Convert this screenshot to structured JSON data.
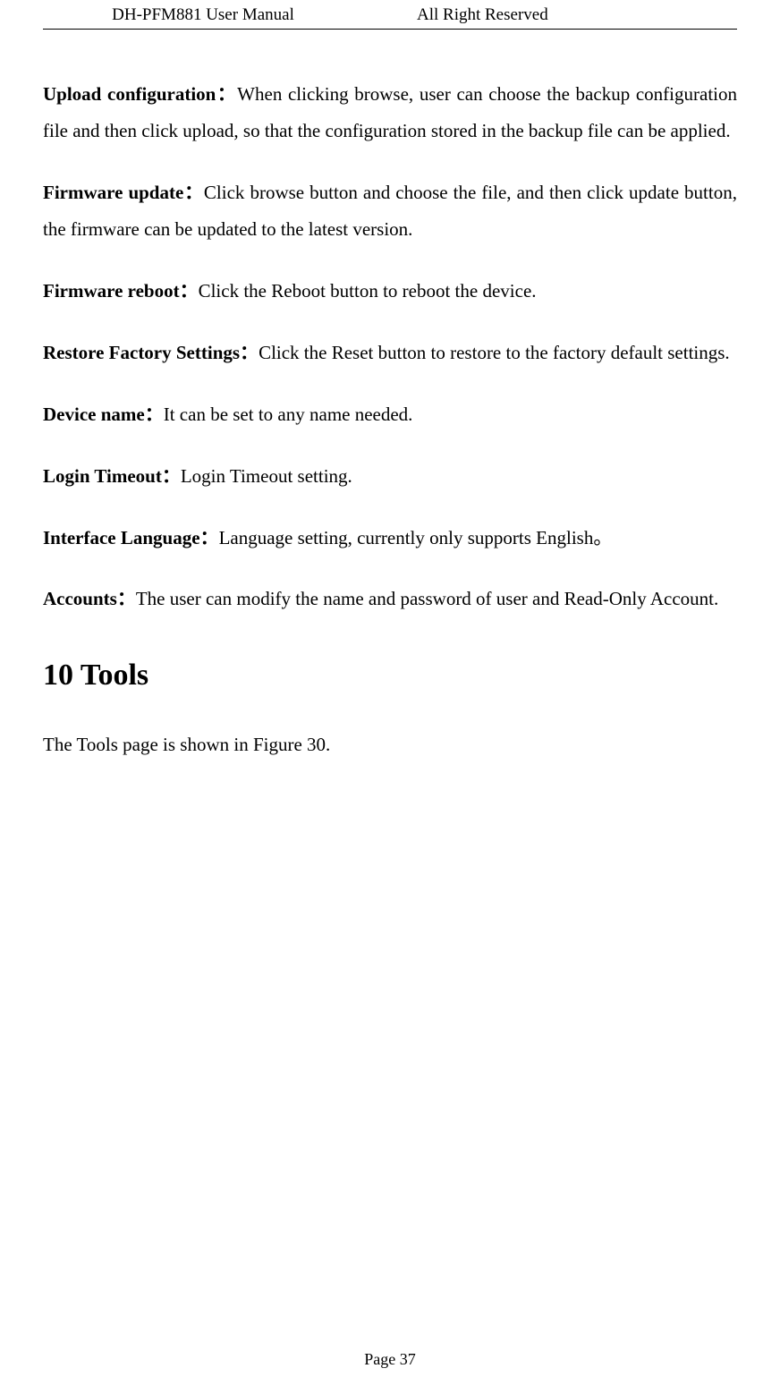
{
  "header": {
    "left": "DH-PFM881 User Manual",
    "right": "All Right Reserved"
  },
  "paragraphs": [
    {
      "bold": "Upload configuration：",
      "text": "When clicking browse, user can choose the backup configuration file and then click upload, so that the configuration stored in the backup file can be applied."
    },
    {
      "bold": "Firmware update：",
      "text": "Click browse button and choose the file, and then click update button, the firmware can be updated to the latest version."
    },
    {
      "bold": "Firmware reboot：",
      "text": "Click the Reboot button to reboot the device."
    },
    {
      "bold": "Restore Factory Settings：",
      "text": "Click the Reset button to restore to the factory default settings."
    },
    {
      "bold": "Device name：",
      "text": "It can be set to any name needed."
    },
    {
      "bold": "Login Timeout：",
      "text": "Login Timeout setting."
    },
    {
      "bold": "Interface Language：",
      "text": "Language setting, currently only supports English。"
    },
    {
      "bold": "Accounts：",
      "text": "The user can modify the name and password of user and Read-Only Account."
    }
  ],
  "section": {
    "title": "10  Tools",
    "intro": "The Tools page is shown in Figure 30."
  },
  "footer": {
    "page_label": "Page 37"
  }
}
